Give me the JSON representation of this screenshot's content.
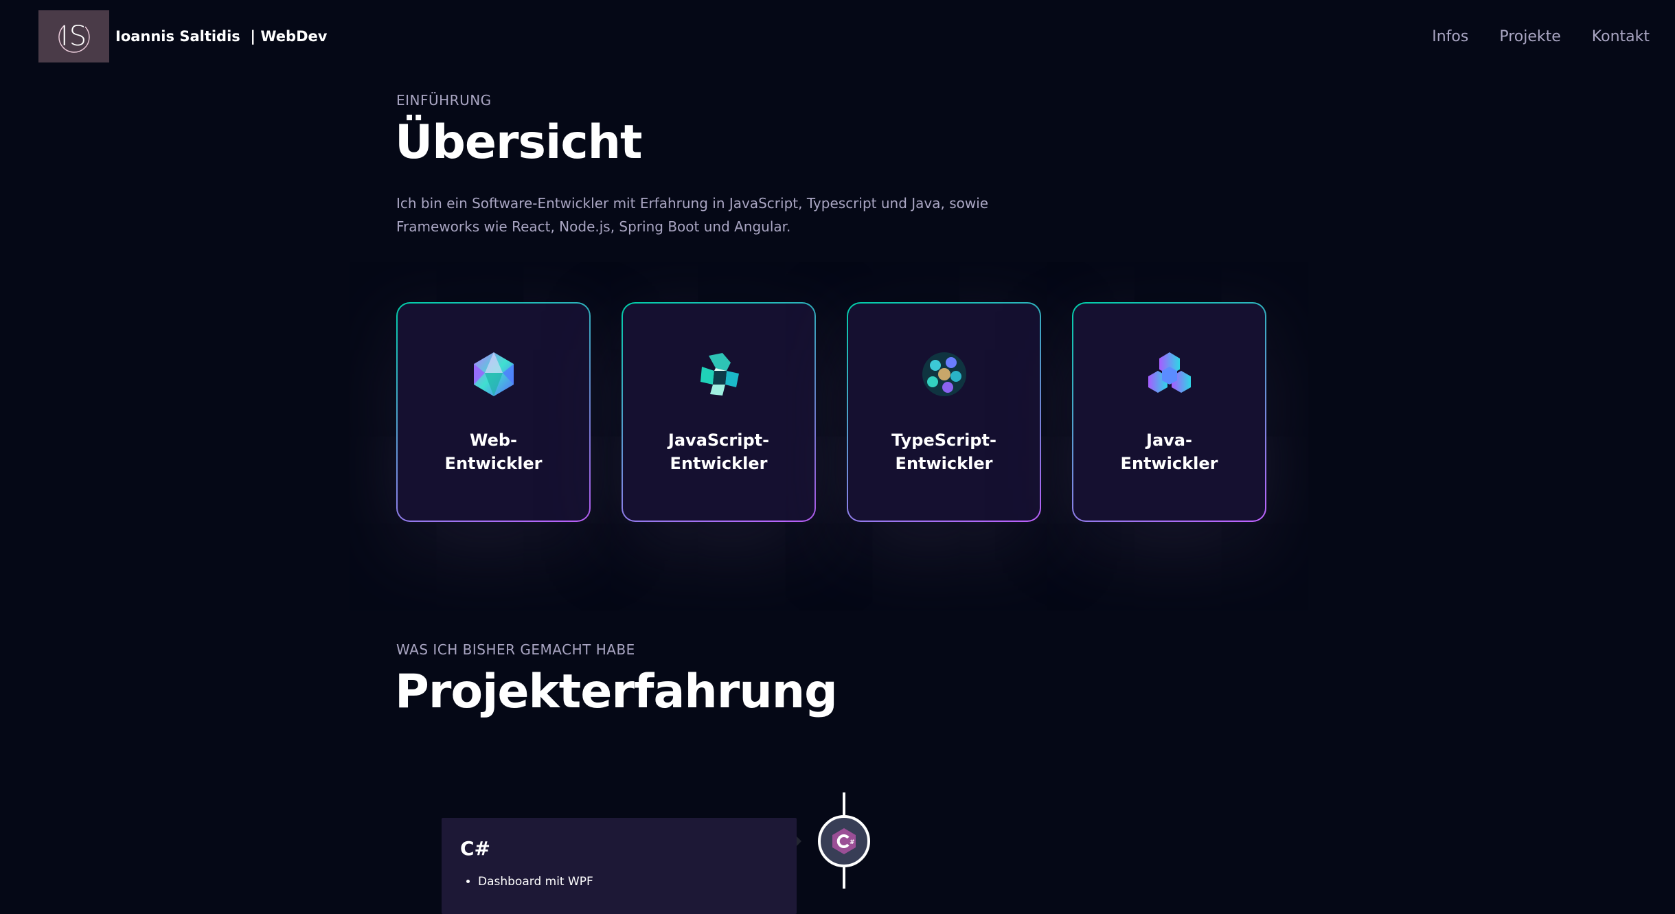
{
  "nav": {
    "logo_text": "IS",
    "brand": "Ioannis Saltidis  | WebDev",
    "links": [
      "Infos",
      "Projekte",
      "Kontakt"
    ]
  },
  "overview": {
    "subtitle": "EINFÜHRUNG",
    "title": "Übersicht",
    "text": "Ich bin ein Software-Entwickler mit Erfahrung in JavaScript, Typescript und Java, sowie Frameworks wie React, Node.js, Spring Boot und Angular.",
    "cards": [
      {
        "title": "Web-\nEntwickler",
        "icon": "web-dev-icon"
      },
      {
        "title": "JavaScript-\nEntwickler",
        "icon": "javascript-icon"
      },
      {
        "title": "TypeScript-\nEntwickler",
        "icon": "typescript-icon"
      },
      {
        "title": "Java-\nEntwickler",
        "icon": "java-icon"
      }
    ]
  },
  "experience": {
    "subtitle": "WAS ICH BISHER GEMACHT HABE",
    "title": "Projekterfahrung",
    "items": [
      {
        "title": "C#",
        "icon": "csharp-icon",
        "points": [
          "Dashboard mit WPF"
        ]
      }
    ]
  },
  "colors": {
    "background": "#050816",
    "secondary_text": "#aaa6c3",
    "card_bg": "#151030",
    "card_border_start": "#00cea8",
    "card_border_end": "#bf61ff",
    "timeline_card_bg": "#1d1836"
  }
}
